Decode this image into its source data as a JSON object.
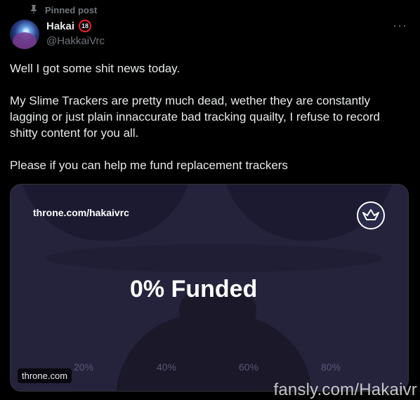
{
  "pinned_label": "Pinned post",
  "author": {
    "name": "Hakai",
    "age_badge": "18",
    "handle": "@HakkaiVrc"
  },
  "text": {
    "line1": "Well I got some shit news today.",
    "line2": "My Slime Trackers are pretty much dead, wether they are constantly lagging or just plain innaccurate bad tracking quailty, I refuse to record shitty content for you all.",
    "line3": "Please if you can help me fund replacement trackers"
  },
  "card": {
    "url": "throne.com/hakaivrc",
    "headline": "0% Funded",
    "ticks": [
      "20%",
      "40%",
      "60%",
      "80%"
    ],
    "domain": "throne.com",
    "funded_fraction": 0
  },
  "watermark": "fansly.com/Hakaivr",
  "icons": {
    "pin": "pin-icon",
    "more": "more-icon",
    "logo": "throne-crown-icon"
  },
  "colors": {
    "background": "#000000",
    "card": "#25233c",
    "age_badge_ring": "#f4212e"
  }
}
